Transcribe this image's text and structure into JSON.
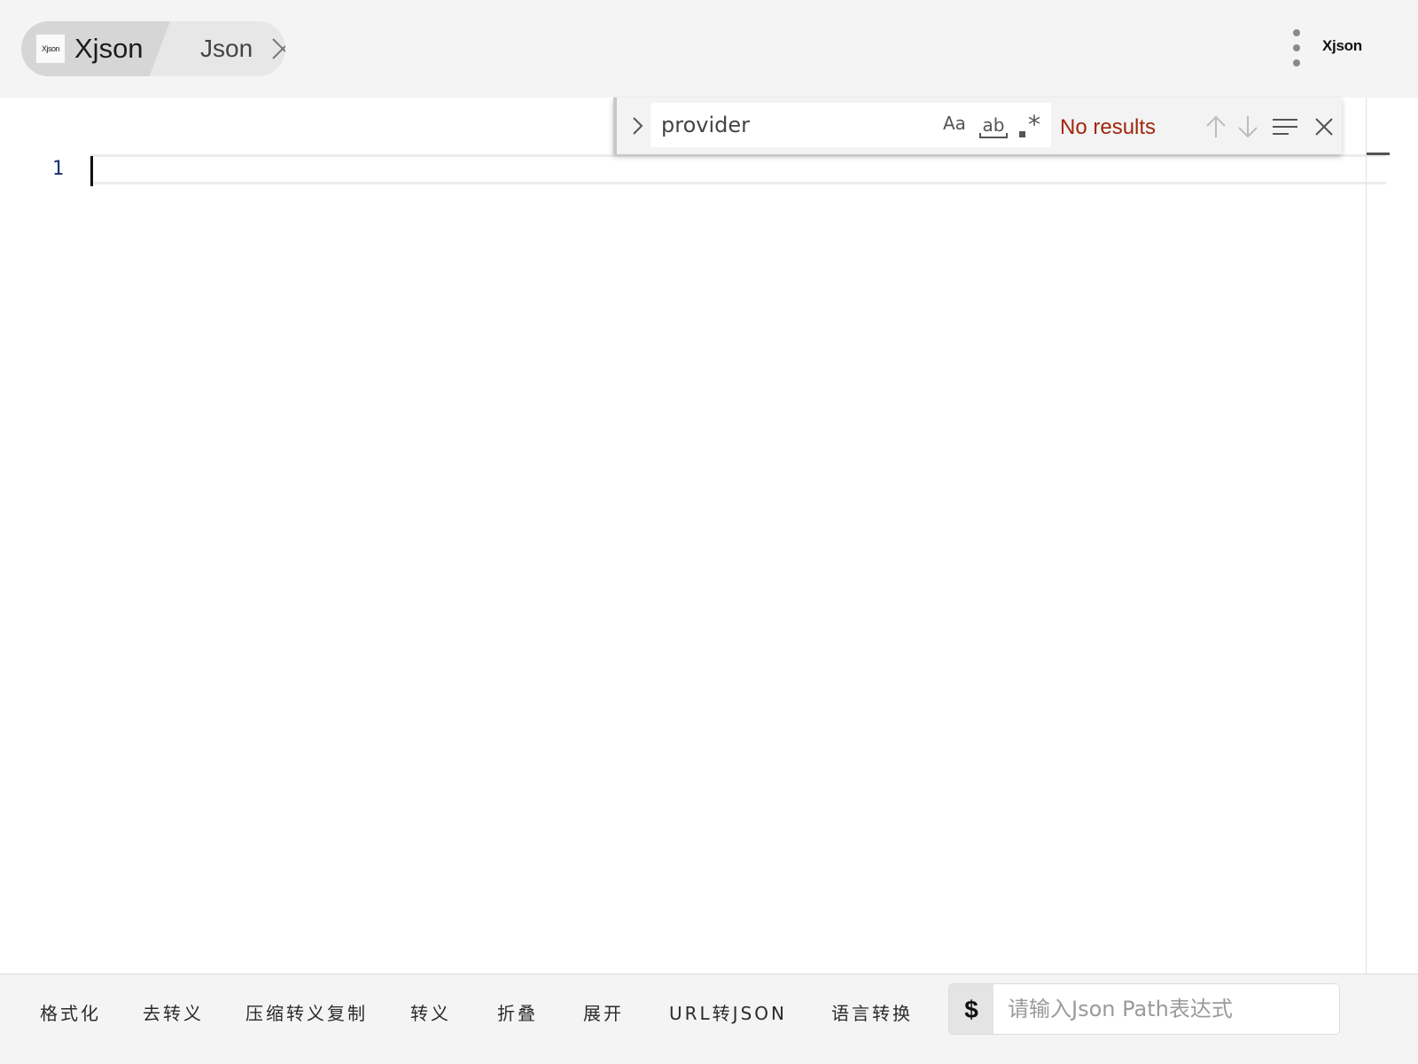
{
  "header": {
    "app_tab": {
      "logo_text": "Xjson",
      "label": "Xjson"
    },
    "doc_tab": {
      "label": "Json"
    },
    "app_name": "Xjson"
  },
  "editor": {
    "line_numbers": [
      "1"
    ],
    "content": ""
  },
  "find": {
    "query": "provider",
    "match_case_label": "Aa",
    "whole_word_label": "ab",
    "regex_label": ".*",
    "result_text": "No results",
    "result_color": "#a1260d"
  },
  "toolbar": {
    "format": "格式化",
    "unescape": "去转义",
    "compress_escape_copy": "压缩转义复制",
    "escape": "转义",
    "fold": "折叠",
    "expand": "展开",
    "url_to_json": "URL转JSON",
    "language_convert": "语言转换"
  },
  "json_path": {
    "prefix": "$",
    "placeholder": "请输入Json Path表达式",
    "value": ""
  },
  "icons": {
    "tab_close": "close-icon",
    "menu": "more-vertical-icon",
    "replace_toggle": "chevron-right-icon",
    "prev": "arrow-up-icon",
    "next": "arrow-down-icon",
    "selection": "find-in-selection-icon",
    "find_close": "close-icon"
  }
}
